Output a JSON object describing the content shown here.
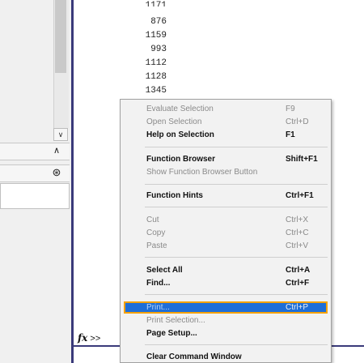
{
  "command_window": {
    "numbers": [
      "1171",
      "876",
      "1159",
      "993",
      "1112",
      "1128",
      "1345"
    ],
    "prompt_symbol": "fx",
    "prompt_arrows": ">>"
  },
  "left_pane": {
    "down_arrow": "∨",
    "up_arrow": "∧",
    "dropdown": "⊛"
  },
  "context_menu": {
    "items": [
      {
        "label": "Evaluate Selection",
        "shortcut": "F9",
        "enabled": false
      },
      {
        "label": "Open Selection",
        "shortcut": "Ctrl+D",
        "enabled": false
      },
      {
        "label": "Help on Selection",
        "shortcut": "F1",
        "enabled": true
      },
      {
        "label": "Function Browser",
        "shortcut": "Shift+F1",
        "enabled": true
      },
      {
        "label": "Show Function Browser Button",
        "shortcut": "",
        "enabled": false
      },
      {
        "label": "Function Hints",
        "shortcut": "Ctrl+F1",
        "enabled": true
      },
      {
        "label": "Cut",
        "shortcut": "Ctrl+X",
        "enabled": false
      },
      {
        "label": "Copy",
        "shortcut": "Ctrl+C",
        "enabled": false
      },
      {
        "label": "Paste",
        "shortcut": "Ctrl+V",
        "enabled": false
      },
      {
        "label": "Select All",
        "shortcut": "Ctrl+A",
        "enabled": true
      },
      {
        "label": "Find...",
        "shortcut": "Ctrl+F",
        "enabled": true
      },
      {
        "label": "Print...",
        "shortcut": "Ctrl+P",
        "enabled": true,
        "highlighted": true
      },
      {
        "label": "Print Selection...",
        "shortcut": "",
        "enabled": false
      },
      {
        "label": "Page Setup...",
        "shortcut": "",
        "enabled": true
      },
      {
        "label": "Clear Command Window",
        "shortcut": "",
        "enabled": true
      }
    ]
  },
  "colors": {
    "highlight_bg": "#1e6ed8",
    "highlight_border": "#f5a20a",
    "divider": "#3a3a7a"
  }
}
